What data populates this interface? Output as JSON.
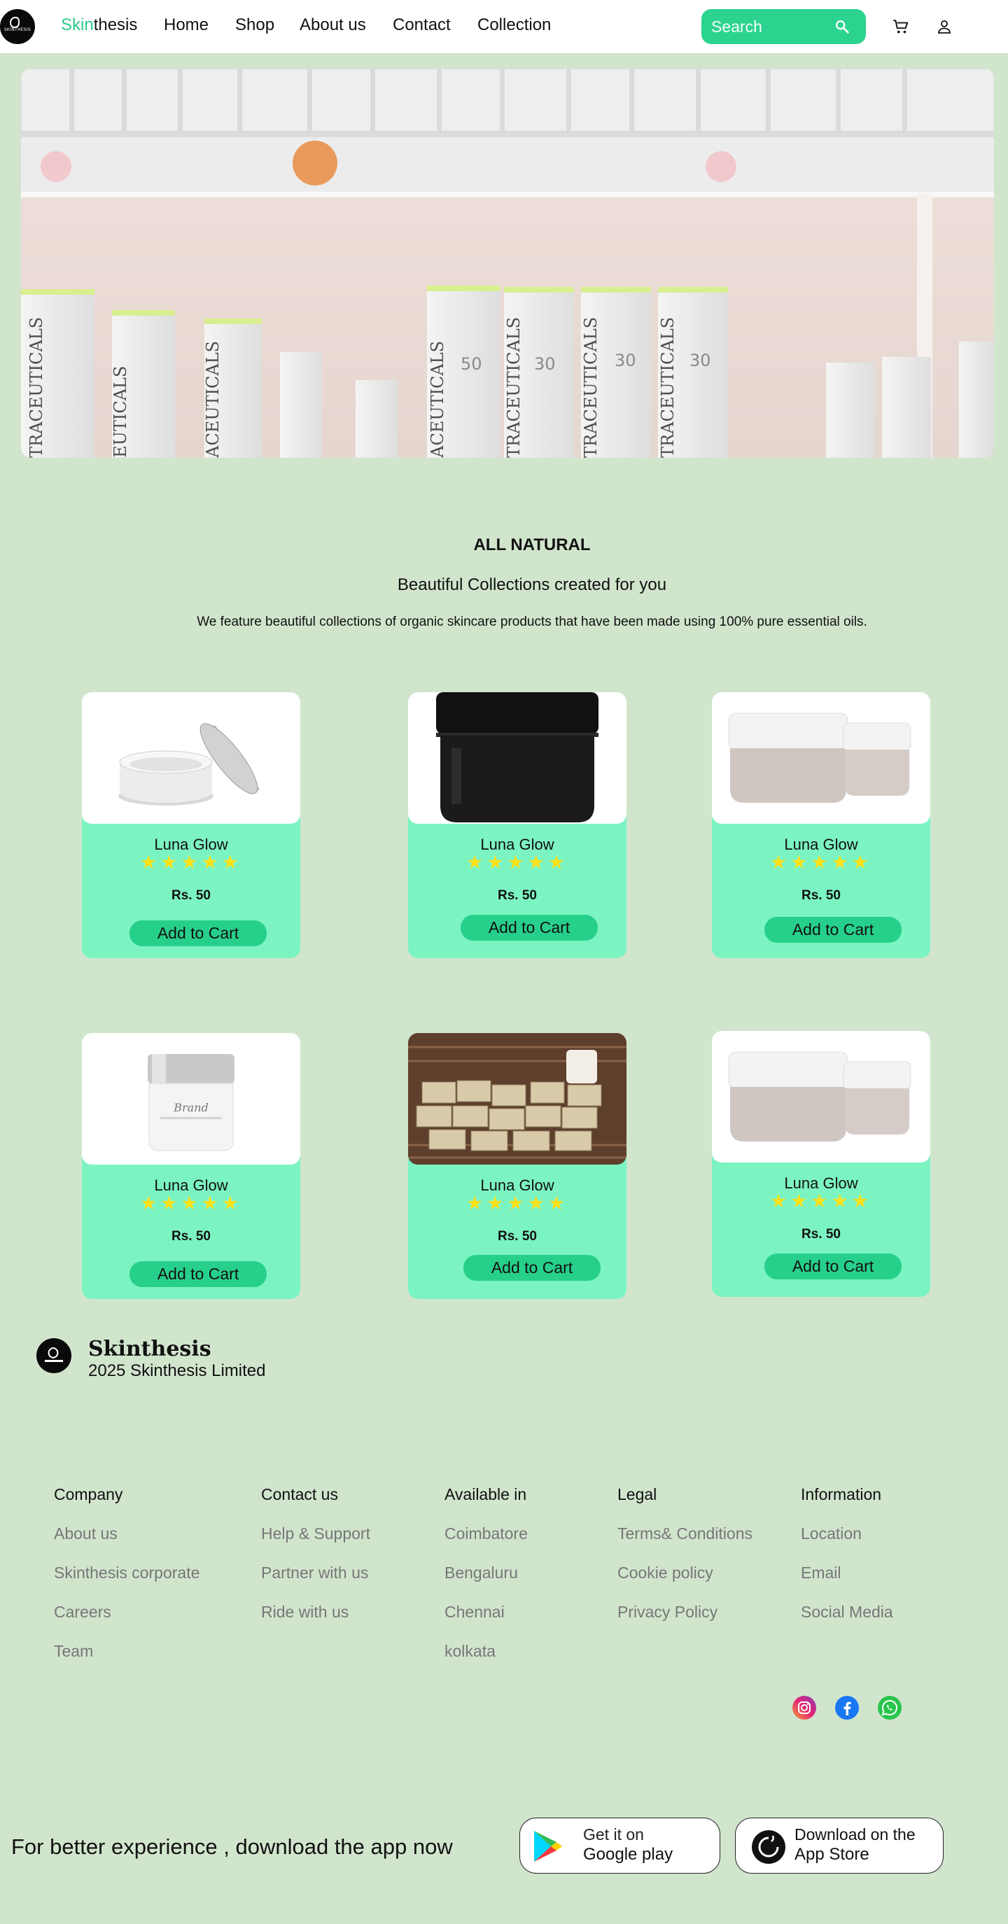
{
  "nav": {
    "logo_text": "SKINTHESIS",
    "brand_accent": "Skin",
    "brand_rest": "thesis",
    "links": [
      "Home",
      "Shop",
      "About us",
      "Contact",
      "Collection"
    ],
    "search_placeholder": "Search",
    "search_icon": "search-icon",
    "cart_icon": "cart-icon",
    "user_icon": "user-icon"
  },
  "intro": {
    "kicker": "ALL NATURAL",
    "heading": "Beautiful Collections created for you",
    "description": "We feature beautiful collections of organic skincare products that have been made using 100% pure essential oils."
  },
  "products": [
    {
      "name": "Luna Glow",
      "stars": "★★★★★",
      "rating": 5,
      "price": "Rs. 50",
      "button": "Add to Cart"
    },
    {
      "name": "Luna Glow",
      "stars": "★★★★★",
      "rating": 5,
      "price": "Rs. 50",
      "button": "Add to Cart"
    },
    {
      "name": "Luna Glow",
      "stars": "★★★★★",
      "rating": 5,
      "price": "Rs. 50",
      "button": "Add to Cart"
    },
    {
      "name": "Luna Glow",
      "stars": "★★★★★",
      "rating": 5,
      "price": "Rs. 50",
      "button": "Add to Cart"
    },
    {
      "name": "Luna Glow",
      "stars": "★★★★★",
      "rating": 5,
      "price": "Rs. 50",
      "button": "Add to Cart"
    },
    {
      "name": "Luna Glow",
      "stars": "★★★★★",
      "rating": 5,
      "price": "Rs. 50",
      "button": "Add to Cart"
    }
  ],
  "footer": {
    "brand": "Skinthesis",
    "copyright": "2025 Skinthesis Limited",
    "columns": [
      {
        "title": "Company",
        "links": [
          "About us",
          "Skinthesis corporate",
          "Careers",
          "Team"
        ]
      },
      {
        "title": "Contact us",
        "links": [
          "Help & Support",
          "Partner with us",
          "Ride with us"
        ]
      },
      {
        "title": "Available in",
        "links": [
          "Coimbatore",
          "Bengaluru",
          "Chennai",
          "kolkata"
        ]
      },
      {
        "title": "Legal",
        "links": [
          "Terms& Conditions",
          "Cookie policy",
          "Privacy Policy"
        ]
      },
      {
        "title": "Information",
        "links": [
          "Location",
          "Email",
          "Social Media"
        ]
      }
    ],
    "social_icons": [
      "instagram-icon",
      "facebook-icon",
      "whatsapp-icon"
    ]
  },
  "app": {
    "prompt": "For better experience , download the app now",
    "google": {
      "line1": "Get it on",
      "line2": "Google play"
    },
    "apple": {
      "line1": "Download on the",
      "line2": "App Store"
    }
  },
  "colors": {
    "page_bg": "#d1e5cd",
    "accent": "#2bd38f",
    "card_bg": "#7cf4c2",
    "star": "#ffe11b"
  }
}
